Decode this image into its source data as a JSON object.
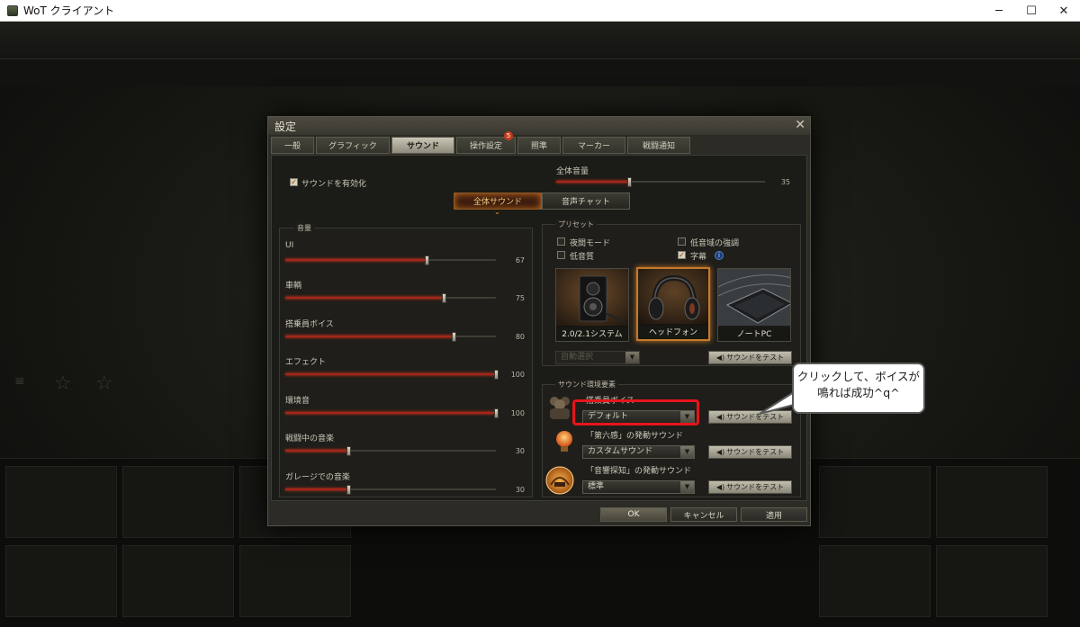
{
  "window": {
    "title": "WoT クライアント",
    "minimize": "─",
    "maximize": "☐",
    "close": "✕"
  },
  "dialog": {
    "title": "設定",
    "tabs": [
      {
        "label": "一般"
      },
      {
        "label": "グラフィック"
      },
      {
        "label": "サウンド"
      },
      {
        "label": "操作設定",
        "badge": "5"
      },
      {
        "label": "照準"
      },
      {
        "label": "マーカー"
      },
      {
        "label": "戦闘通知"
      }
    ],
    "active_tab": "サウンド"
  },
  "sound": {
    "enable_label": "サウンドを有効化",
    "enable_checked": true,
    "master": {
      "label": "全体音量",
      "value": 35
    },
    "subtabs": [
      {
        "label": "全体サウンド"
      },
      {
        "label": "音声チャット"
      }
    ],
    "active_subtab": "全体サウンド"
  },
  "volume": {
    "legend": "音量",
    "sliders": [
      {
        "label": "UI",
        "value": 67
      },
      {
        "label": "車輌",
        "value": 75
      },
      {
        "label": "搭乗員ボイス",
        "value": 80
      },
      {
        "label": "エフェクト",
        "value": 100
      },
      {
        "label": "環境音",
        "value": 100
      },
      {
        "label": "戦闘中の音楽",
        "value": 30
      },
      {
        "label": "ガレージでの音楽",
        "value": 30
      }
    ]
  },
  "presets": {
    "legend": "プリセット",
    "checkboxes": [
      {
        "label": "夜間モード",
        "checked": false
      },
      {
        "label": "低音域の強調",
        "checked": false
      },
      {
        "label": "低音質",
        "checked": false
      },
      {
        "label": "字幕",
        "checked": true
      }
    ],
    "info_icon": "i",
    "cards": [
      {
        "label": "2.0/2.1システム"
      },
      {
        "label": "ヘッドフォン"
      },
      {
        "label": "ノートPC"
      }
    ],
    "active_card": "ヘッドフォン",
    "auto_select": "自動選択",
    "test_label": "サウンドをテスト"
  },
  "environment": {
    "legend": "サウンド環境要素",
    "items": [
      {
        "label": "搭乗員ボイス",
        "selected": "デフォルト"
      },
      {
        "label": "「第六感」の発動サウンド",
        "selected": "カスタムサウンド"
      },
      {
        "label": "「音響探知」の発動サウンド",
        "selected": "標準"
      }
    ],
    "test_label": "サウンドをテスト"
  },
  "footer": {
    "ok": "OK",
    "cancel": "キャンセル",
    "apply": "適用"
  },
  "annotation": {
    "line1": "クリックして、ボイスが",
    "line2": "鳴れば成功^q^"
  },
  "colors": {
    "accent_red": "#e8141a",
    "slider_fill": "#a7251a",
    "active_tab": "#c9c5b3"
  }
}
